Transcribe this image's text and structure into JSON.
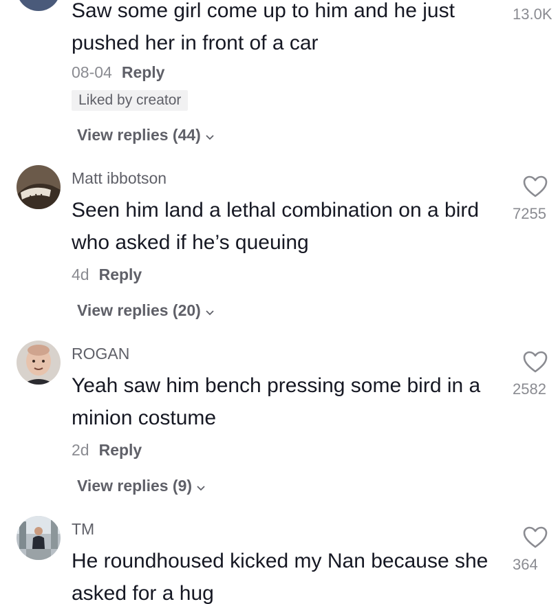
{
  "comments": [
    {
      "username": "",
      "text": "Saw some girl come up to him and he just pushed her in front of a car",
      "date": "08-04",
      "reply_label": "Reply",
      "liked_badge": "Liked by creator",
      "view_replies": "View replies (44)",
      "likes": "13.0K"
    },
    {
      "username": "Matt ibbotson",
      "text": "Seen him land a lethal combination on a bird who asked if he’s queuing",
      "date": "4d",
      "reply_label": "Reply",
      "view_replies": "View replies (20)",
      "likes": "7255"
    },
    {
      "username": "ROGAN",
      "text": "Yeah saw him bench pressing some bird in a minion costume",
      "date": "2d",
      "reply_label": "Reply",
      "view_replies": "View replies (9)",
      "likes": "2582"
    },
    {
      "username": "TM",
      "text": "He roundhoused kicked my Nan because she asked for a hug",
      "likes": "364"
    }
  ],
  "icons": {
    "like": "heart-outline-icon",
    "expand": "chevron-down-icon"
  },
  "colors": {
    "text": "#161823",
    "secondary": "#5f6068",
    "muted": "#8a8b91",
    "badge_bg": "#f1f1f2"
  }
}
